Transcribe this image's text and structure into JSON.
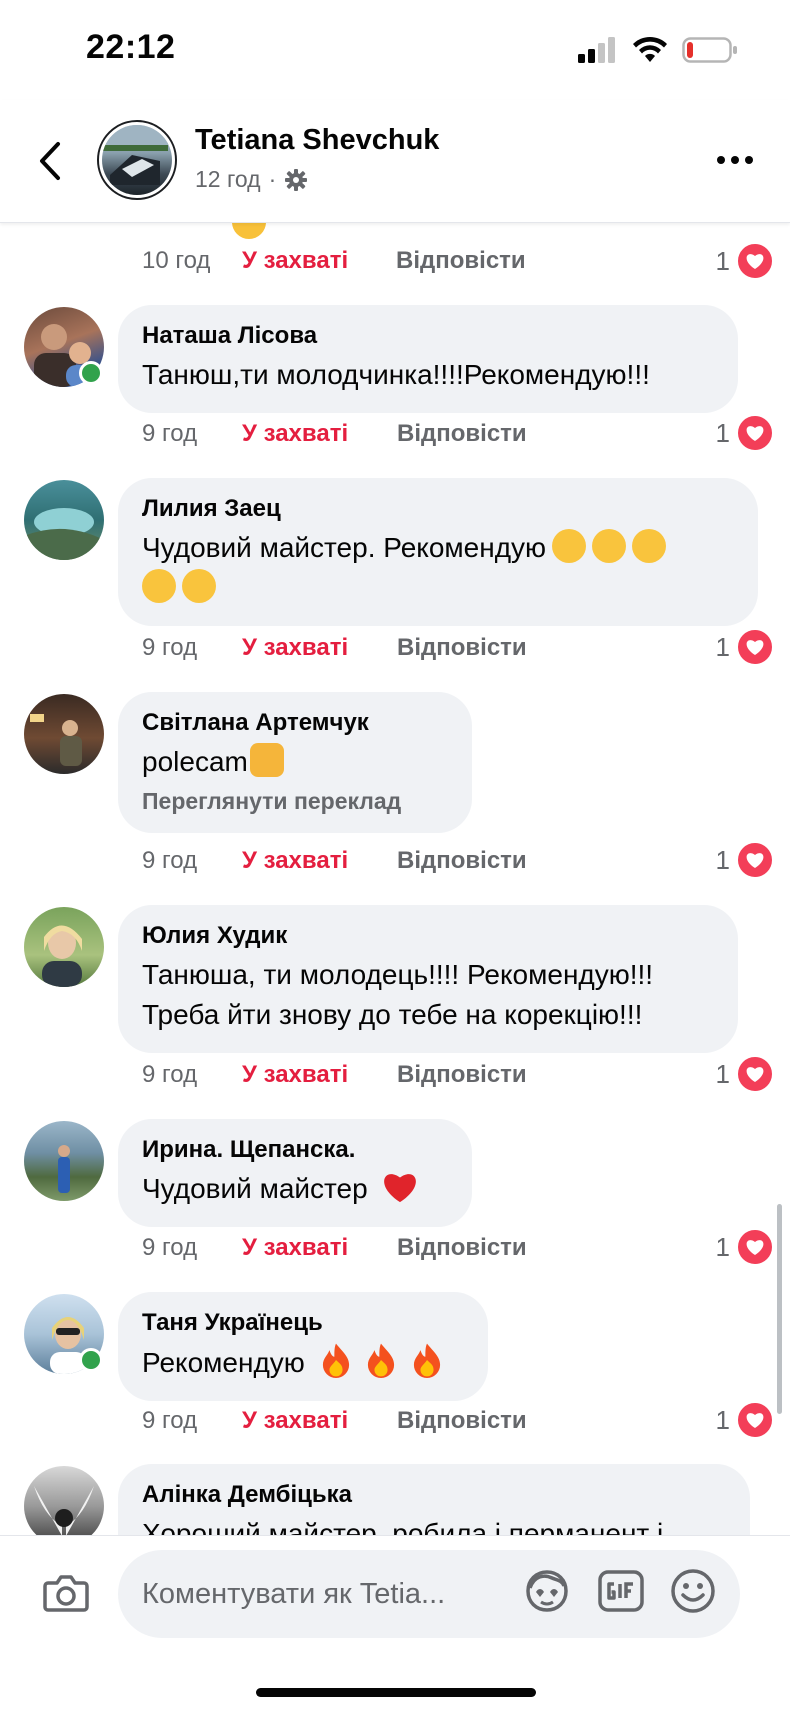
{
  "status_bar": {
    "time": "22:12",
    "battery_level": 0.15
  },
  "header": {
    "name": "Tetiana Shevchuk",
    "time": "12 год",
    "separator": "·"
  },
  "first_meta": {
    "time": "10 год",
    "like": "У захваті",
    "reply": "Відповісти",
    "reactions": "1"
  },
  "comments": [
    {
      "author": "Наташа Лісова",
      "text": "Танюш,ти молодчинка!!!!Рекомендую!!!",
      "time": "9 год",
      "like": "У захваті",
      "reply": "Відповісти",
      "reactions": "1",
      "online": true
    },
    {
      "author": "Лилия Заец",
      "text": "Чудовий майстер. Рекомендую",
      "emoji": "kissing-face-icon",
      "time": "9 год",
      "like": "У захваті",
      "reply": "Відповісти",
      "reactions": "1",
      "online": false
    },
    {
      "author": "Світлана Артемчук",
      "text": "polecam",
      "translate": "Переглянути переклад",
      "emoji": "thumbs-up-icon",
      "time": "9 год",
      "like": "У захваті",
      "reply": "Відповісти",
      "reactions": "1",
      "online": false
    },
    {
      "author": "Юлия Худик",
      "text": "Танюша, ти молодець!!!! Рекомендую!!!",
      "text2": "Треба йти знову до тебе на корекцію!!!",
      "time": "9 год",
      "like": "У захваті",
      "reply": "Відповісти",
      "reactions": "1",
      "online": false
    },
    {
      "author": "Ирина. Щепанска.",
      "text": "Чудовий майстер",
      "emoji": "red-heart-icon",
      "time": "9 год",
      "like": "У захваті",
      "reply": "Відповісти",
      "reactions": "1",
      "online": false
    },
    {
      "author": "Таня Українець",
      "text": "Рекомендую",
      "emoji": "fire-icon",
      "time": "9 год",
      "like": "У захваті",
      "reply": "Відповісти",
      "reactions": "1",
      "online": true
    },
    {
      "author": "Алінка Дембіцька",
      "text": "Хороший майстер, робила і перманент і",
      "online": false
    }
  ],
  "composer": {
    "placeholder": "Коментувати як Tetia..."
  },
  "colors": {
    "accent_like": "#e41e3f",
    "bubble": "#f0f2f5",
    "secondary_text": "#65676b",
    "heart": "#f33e58",
    "online": "#31a24c"
  }
}
